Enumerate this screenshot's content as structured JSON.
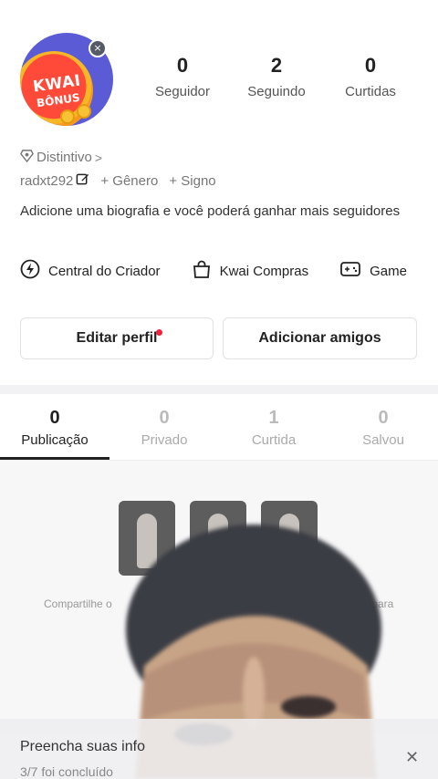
{
  "avatar": {
    "promo_line1": "KWAI",
    "promo_line2": "BÔNUS",
    "close_glyph": "×"
  },
  "stats": [
    {
      "value": "0",
      "label": "Seguidor"
    },
    {
      "value": "2",
      "label": "Seguindo"
    },
    {
      "value": "0",
      "label": "Curtidas"
    }
  ],
  "badge": {
    "label": "Distintivo",
    "chevron": ">"
  },
  "meta": {
    "username": "radxt292",
    "gender": "+ Gênero",
    "sign": "+ Signo"
  },
  "bio": "Adicione uma biografia e você poderá ganhar mais seguidores",
  "shortcuts": [
    {
      "icon": "lightning-icon",
      "label": "Central do Criador"
    },
    {
      "icon": "shopping-bag-icon",
      "label": "Kwai Compras"
    },
    {
      "icon": "gamepad-icon",
      "label": "Game"
    }
  ],
  "buttons": {
    "edit": "Editar perfil",
    "add_friends": "Adicionar amigos"
  },
  "tabs": [
    {
      "count": "0",
      "label": "Publicação",
      "active": true
    },
    {
      "count": "0",
      "label": "Privado"
    },
    {
      "count": "1",
      "label": "Curtida"
    },
    {
      "count": "0",
      "label": "Salvou"
    }
  ],
  "empty": {
    "share_left": "Compartilhe o",
    "share_right": "r para"
  },
  "bottom_banner": {
    "title": "Preencha suas info",
    "progress": "3/7 foi concluído",
    "close_glyph": "✕"
  },
  "colors": {
    "accent_dot": "#f0213a",
    "avatar_bg": "#5b5bd6"
  }
}
